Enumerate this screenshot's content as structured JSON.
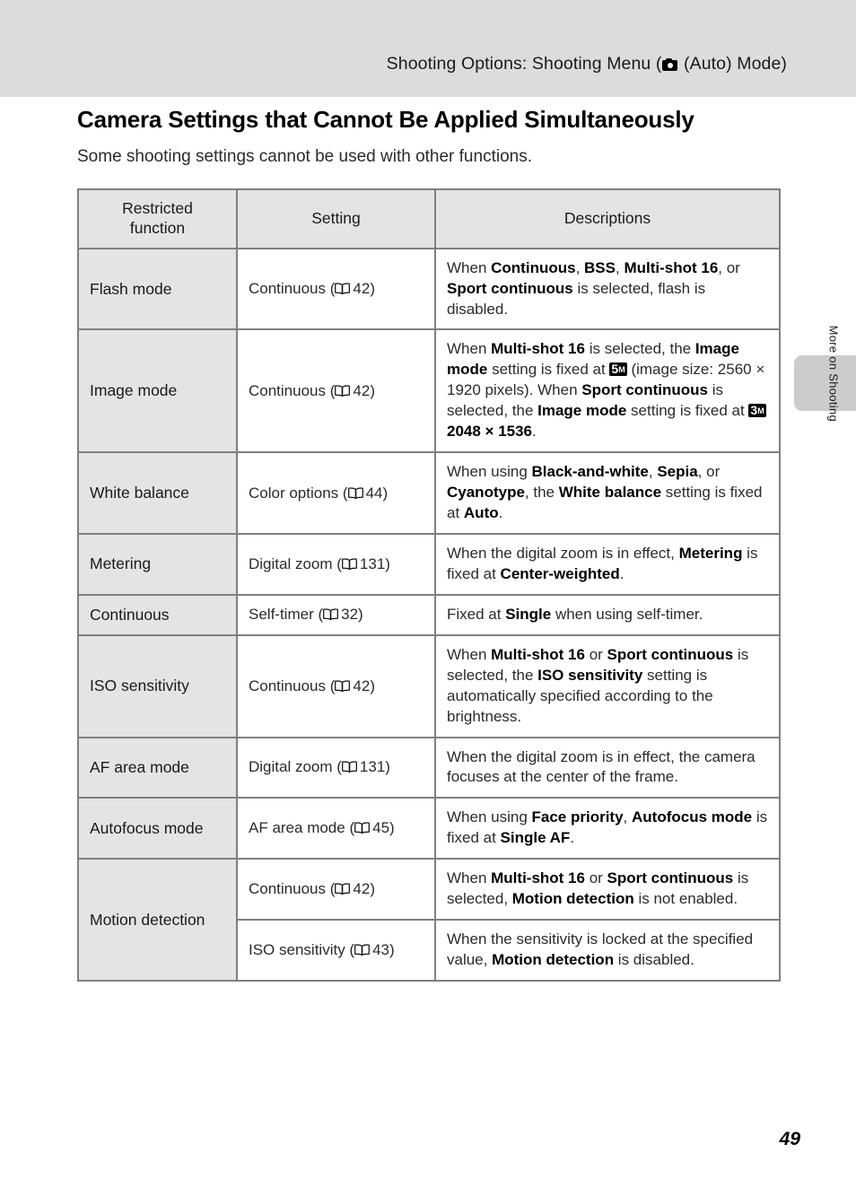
{
  "header": {
    "running_title_before": "Shooting Options: Shooting Menu (",
    "camera_icon": "camera-icon",
    "running_title_after": " (Auto) Mode)"
  },
  "side_tab": {
    "label": "More on Shooting"
  },
  "page": {
    "heading": "Camera Settings that Cannot Be Applied Simultaneously",
    "intro": "Some shooting settings cannot be used with other functions.",
    "number": "49"
  },
  "table": {
    "headers": {
      "restricted_function": "Restricted\nfunction",
      "restricted_function_line1": "Restricted",
      "restricted_function_line2": "function",
      "setting": "Setting",
      "descriptions": "Descriptions"
    },
    "rows": [
      {
        "function": "Flash mode",
        "setting_text": "Continuous (",
        "setting_page": "42",
        "setting_tail": ")",
        "description_plain": "When Continuous, BSS, Multi-shot 16, or Sport continuous is selected, flash is disabled.",
        "description_parts": [
          {
            "t": "When ",
            "b": false
          },
          {
            "t": "Continuous",
            "b": true
          },
          {
            "t": ", ",
            "b": false
          },
          {
            "t": "BSS",
            "b": true
          },
          {
            "t": ", ",
            "b": false
          },
          {
            "t": "Multi-shot 16",
            "b": true
          },
          {
            "t": ", or ",
            "b": false
          },
          {
            "t": "Sport continuous",
            "b": true
          },
          {
            "t": " is selected, flash is disabled.",
            "b": false
          }
        ]
      },
      {
        "function": "Image mode",
        "setting_text": "Continuous (",
        "setting_page": "42",
        "setting_tail": ")",
        "description_plain": "When Multi-shot 16 is selected, the Image mode setting is fixed at 5M (image size: 2560 × 1920 pixels). When Sport continuous is selected, the Image mode setting is fixed at 3M 2048 × 1536.",
        "description_parts": [
          {
            "t": "When ",
            "b": false
          },
          {
            "t": "Multi-shot 16",
            "b": true
          },
          {
            "t": " is selected, the ",
            "b": false
          },
          {
            "t": "Image mode",
            "b": true
          },
          {
            "t": " setting is fixed at ",
            "b": false
          },
          {
            "badge": "5",
            "badge_sub": "M"
          },
          {
            "t": " (image size: 2560 × 1920 pixels). When ",
            "b": false
          },
          {
            "t": "Sport continuous",
            "b": true
          },
          {
            "t": " is selected, the ",
            "b": false
          },
          {
            "t": "Image mode",
            "b": true
          },
          {
            "t": " setting is fixed at ",
            "b": false
          },
          {
            "badge": "3",
            "badge_sub": "M"
          },
          {
            "t": " ",
            "b": false
          },
          {
            "t": "2048 × 1536",
            "b": true
          },
          {
            "t": ".",
            "b": false
          }
        ]
      },
      {
        "function": "White balance",
        "setting_text": "Color options (",
        "setting_page": "44",
        "setting_tail": ")",
        "description_plain": "When using Black-and-white, Sepia, or Cyanotype, the White balance setting is fixed at Auto.",
        "description_parts": [
          {
            "t": "When using ",
            "b": false
          },
          {
            "t": "Black-and-white",
            "b": true
          },
          {
            "t": ", ",
            "b": false
          },
          {
            "t": "Sepia",
            "b": true
          },
          {
            "t": ", or ",
            "b": false
          },
          {
            "t": "Cyanotype",
            "b": true
          },
          {
            "t": ", the ",
            "b": false
          },
          {
            "t": "White balance",
            "b": true
          },
          {
            "t": " setting is fixed at ",
            "b": false
          },
          {
            "t": "Auto",
            "b": true
          },
          {
            "t": ".",
            "b": false
          }
        ]
      },
      {
        "function": "Metering",
        "setting_text": "Digital zoom (",
        "setting_page": "131",
        "setting_tail": ")",
        "description_plain": "When the digital zoom is in effect, Metering is fixed at Center-weighted.",
        "description_parts": [
          {
            "t": "When the digital zoom is in effect, ",
            "b": false
          },
          {
            "t": "Metering",
            "b": true
          },
          {
            "t": " is fixed at ",
            "b": false
          },
          {
            "t": "Center-weighted",
            "b": true
          },
          {
            "t": ".",
            "b": false
          }
        ]
      },
      {
        "function": "Continuous",
        "setting_text": "Self-timer (",
        "setting_page": "32",
        "setting_tail": ")",
        "description_plain": "Fixed at Single when using self-timer.",
        "description_parts": [
          {
            "t": "Fixed at ",
            "b": false
          },
          {
            "t": "Single",
            "b": true
          },
          {
            "t": " when using self-timer.",
            "b": false
          }
        ]
      },
      {
        "function": "ISO sensitivity",
        "setting_text": "Continuous (",
        "setting_page": "42",
        "setting_tail": ")",
        "description_plain": "When Multi-shot 16 or Sport continuous is selected, the ISO sensitivity setting is automatically specified according to the brightness.",
        "description_parts": [
          {
            "t": "When ",
            "b": false
          },
          {
            "t": "Multi-shot 16",
            "b": true
          },
          {
            "t": " or ",
            "b": false
          },
          {
            "t": "Sport continuous",
            "b": true
          },
          {
            "t": " is selected, the ",
            "b": false
          },
          {
            "t": "ISO sensitivity",
            "b": true
          },
          {
            "t": " setting is automatically specified according to the brightness.",
            "b": false
          }
        ]
      },
      {
        "function": "AF area mode",
        "setting_text": "Digital zoom (",
        "setting_page": "131",
        "setting_tail": ")",
        "description_plain": "When the digital zoom is in effect, the camera focuses at the center of the frame.",
        "description_parts": [
          {
            "t": "When the digital zoom is in effect, the camera focuses at the center of the frame.",
            "b": false
          }
        ]
      },
      {
        "function": "Autofocus mode",
        "setting_text": "AF area mode (",
        "setting_page": "45",
        "setting_tail": ")",
        "description_plain": "When using Face priority, Autofocus mode is fixed at Single AF.",
        "description_parts": [
          {
            "t": "When using ",
            "b": false
          },
          {
            "t": "Face priority",
            "b": true
          },
          {
            "t": ", ",
            "b": false
          },
          {
            "t": "Autofocus mode",
            "b": true
          },
          {
            "t": " is fixed at ",
            "b": false
          },
          {
            "t": "Single AF",
            "b": true
          },
          {
            "t": ".",
            "b": false
          }
        ]
      },
      {
        "function": "Motion detection",
        "rowspan": 2,
        "setting_text": "Continuous (",
        "setting_page": "42",
        "setting_tail": ")",
        "description_plain": "When Multi-shot 16 or Sport continuous is selected, Motion detection is not enabled.",
        "description_parts": [
          {
            "t": "When ",
            "b": false
          },
          {
            "t": "Multi-shot 16",
            "b": true
          },
          {
            "t": " or ",
            "b": false
          },
          {
            "t": "Sport continuous",
            "b": true
          },
          {
            "t": " is selected, ",
            "b": false
          },
          {
            "t": "Motion detection",
            "b": true
          },
          {
            "t": " is not enabled.",
            "b": false
          }
        ]
      },
      {
        "function": "",
        "continued": true,
        "setting_text": "ISO sensitivity (",
        "setting_page": "43",
        "setting_tail": ")",
        "description_plain": "When the sensitivity is locked at the specified value, Motion detection is disabled.",
        "description_parts": [
          {
            "t": "When the sensitivity is locked at the specified value, ",
            "b": false
          },
          {
            "t": "Motion detection",
            "b": true
          },
          {
            "t": " is disabled.",
            "b": false
          }
        ]
      }
    ]
  },
  "colors": {
    "header_band": "#dcdcdc",
    "side_tab": "#cccccc",
    "cell_shade": "#e4e4e4",
    "border": "#808080"
  }
}
